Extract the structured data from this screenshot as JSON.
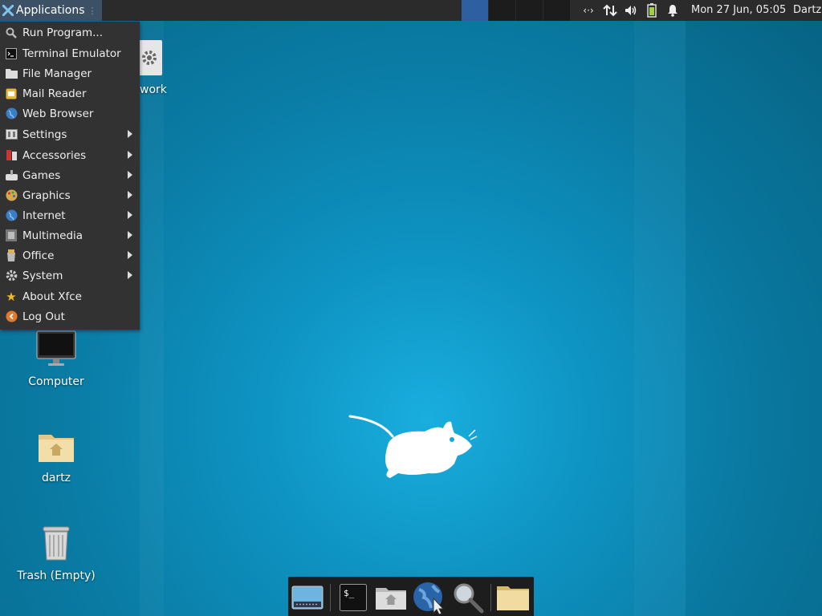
{
  "top_panel": {
    "apps_label": "Applications",
    "workspaces": [
      "1",
      "2",
      "3",
      "4"
    ],
    "active_workspace": 1,
    "clock": "Mon 27 Jun, 05:05",
    "user": "Dartz",
    "tray_icons": [
      "network-icon",
      "transfer-icon",
      "volume-icon",
      "battery-icon",
      "notification-bell-icon"
    ],
    "colors": {
      "panel": "#2b2b2b",
      "apps_button": "#3d5166",
      "active_workspace": "#2d5fa1"
    }
  },
  "menu": {
    "items": [
      {
        "label": "Run Program...",
        "icon": "search-icon",
        "submenu": false
      },
      {
        "label": "Terminal Emulator",
        "icon": "terminal-icon",
        "submenu": false
      },
      {
        "label": "File Manager",
        "icon": "folder-icon",
        "submenu": false
      },
      {
        "label": "Mail Reader",
        "icon": "mail-icon",
        "submenu": false
      },
      {
        "label": "Web Browser",
        "icon": "globe-icon",
        "submenu": false
      },
      {
        "label": "Settings",
        "icon": "settings-icon",
        "submenu": true
      },
      {
        "label": "Accessories",
        "icon": "accessories-icon",
        "submenu": true
      },
      {
        "label": "Games",
        "icon": "games-icon",
        "submenu": true
      },
      {
        "label": "Graphics",
        "icon": "graphics-icon",
        "submenu": true
      },
      {
        "label": "Internet",
        "icon": "internet-icon",
        "submenu": true
      },
      {
        "label": "Multimedia",
        "icon": "multimedia-icon",
        "submenu": true
      },
      {
        "label": "Office",
        "icon": "office-icon",
        "submenu": true
      },
      {
        "label": "System",
        "icon": "system-gear-icon",
        "submenu": true
      },
      {
        "label": "About Xfce",
        "icon": "star-icon",
        "submenu": false
      },
      {
        "label": "Log Out",
        "icon": "logout-icon",
        "submenu": false
      }
    ]
  },
  "desktop": {
    "icons": [
      {
        "label": "work",
        "icon": "settings-launcher-icon"
      },
      {
        "label": "Computer",
        "icon": "computer-icon"
      },
      {
        "label": "dartz",
        "icon": "home-folder-icon"
      },
      {
        "label": "Trash (Empty)",
        "icon": "trash-icon"
      }
    ]
  },
  "dock": {
    "items": [
      "show-desktop-icon",
      "terminal-icon",
      "home-folder-icon",
      "web-browser-icon",
      "app-finder-icon",
      "files-folder-icon"
    ]
  }
}
